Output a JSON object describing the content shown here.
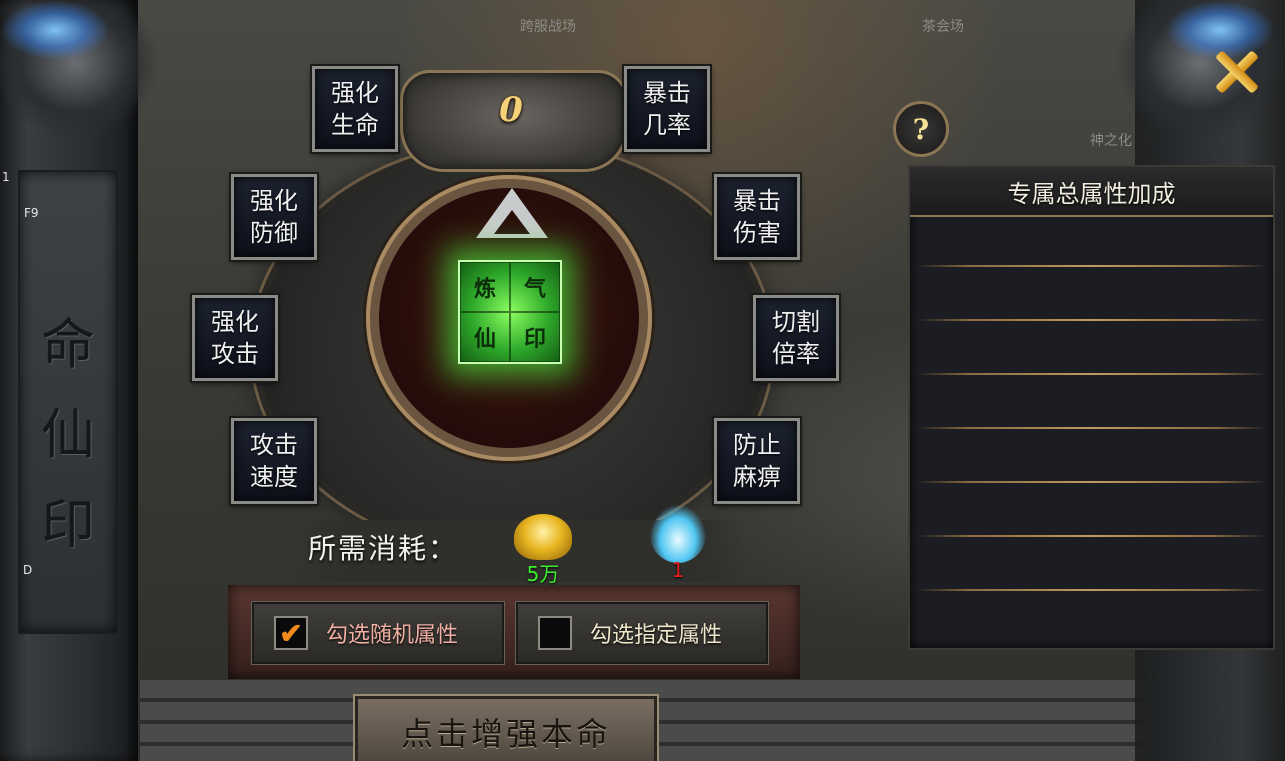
{
  "side_tags": {
    "f9": "F9",
    "one": "1",
    "d": "D"
  },
  "background_labels": {
    "arena": "跨服战场",
    "hall": "茶会场",
    "god": "神之化"
  },
  "pillar": {
    "chars": [
      "命",
      "仙",
      "印"
    ]
  },
  "enhance_count": "0",
  "seal": {
    "chars": [
      "炼",
      "气",
      "仙",
      "印"
    ]
  },
  "stats": [
    {
      "id": "life",
      "label": [
        "强化",
        "生命"
      ]
    },
    {
      "id": "defense",
      "label": [
        "强化",
        "防御"
      ]
    },
    {
      "id": "attack",
      "label": [
        "强化",
        "攻击"
      ]
    },
    {
      "id": "attack-speed",
      "label": [
        "攻击",
        "速度"
      ]
    },
    {
      "id": "crit-rate",
      "label": [
        "暴击",
        "几率"
      ]
    },
    {
      "id": "crit-damage",
      "label": [
        "暴击",
        "伤害"
      ]
    },
    {
      "id": "cut-rate",
      "label": [
        "切割",
        "倍率"
      ]
    },
    {
      "id": "anti-paralysis",
      "label": [
        "防止",
        "麻痹"
      ]
    }
  ],
  "cost": {
    "label": "所需消耗：",
    "gold": {
      "icon": "gold-ingot-icon",
      "amount": "5万",
      "color": "#3cf02c"
    },
    "soul": {
      "icon": "blue-soul-flame-icon",
      "amount": "1",
      "color": "#e21d1d"
    }
  },
  "options": {
    "random": {
      "label": "勾选随机属性",
      "checked": true
    },
    "specified": {
      "label": "勾选指定属性",
      "checked": false
    }
  },
  "main_button": {
    "label": "点击增强本命"
  },
  "help": {
    "label": "?"
  },
  "bonus_panel": {
    "title": "专属总属性加成",
    "rows": [
      "",
      "",
      "",
      "",
      "",
      "",
      "",
      ""
    ]
  },
  "colors": {
    "accent_gold": "#f5d27a",
    "seal_green": "#2ea82a",
    "check_orange": "#f08a1a"
  }
}
